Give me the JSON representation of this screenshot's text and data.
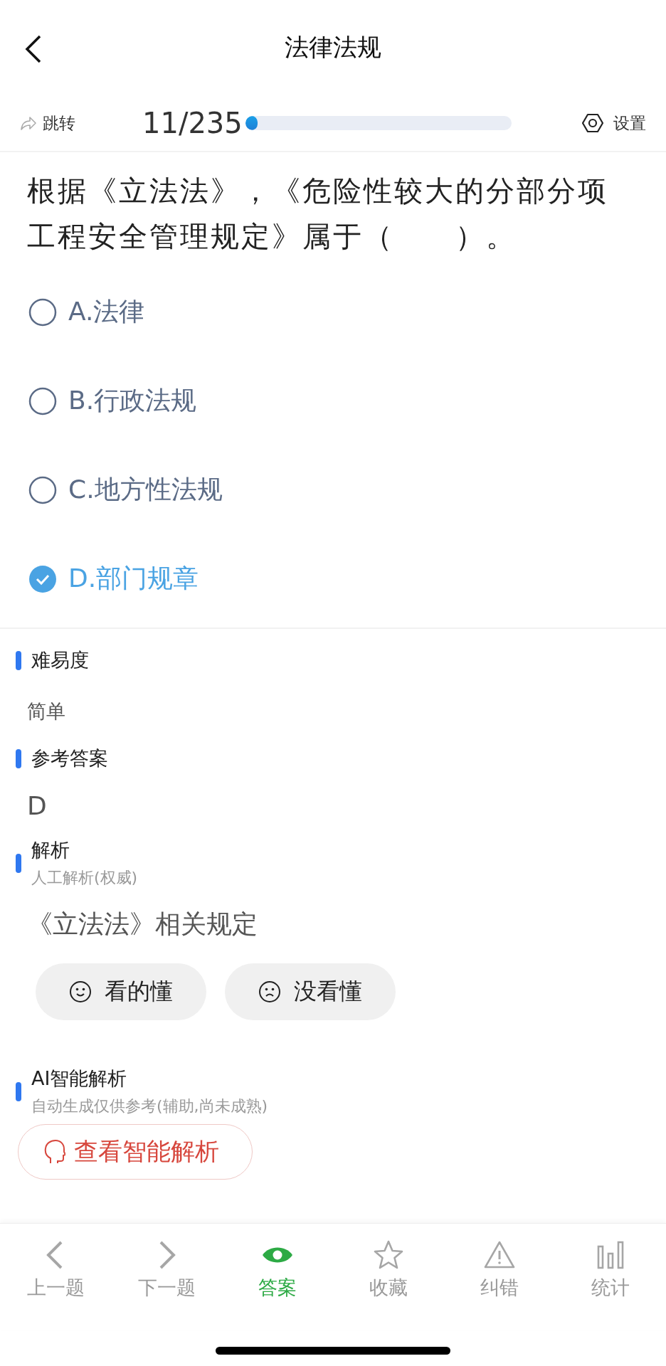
{
  "nav": {
    "title": "法律法规"
  },
  "toolbar": {
    "jump": "跳转",
    "counter": "11/235",
    "progress": {
      "level": 0.047
    },
    "settings": "设置"
  },
  "question": "根据《立法法》，《危险性较大的分部分项工程安全管理规定》属于（　　）。",
  "options": [
    {
      "label": "A.法律",
      "selected": false
    },
    {
      "label": "B.行政法规",
      "selected": false
    },
    {
      "label": "C.地方性法规",
      "selected": false
    },
    {
      "label": "D.部门规章",
      "selected": true
    }
  ],
  "difficulty": {
    "heading": "难易度",
    "value": "简单"
  },
  "answer": {
    "heading": "参考答案",
    "value": "D"
  },
  "analysis": {
    "heading": "解析",
    "subtitle": "人工解析(权威)",
    "text": "《立法法》相关规定",
    "feedback": [
      {
        "kind": "smile",
        "label": "看的懂"
      },
      {
        "kind": "frown",
        "label": "没看懂"
      }
    ]
  },
  "ai": {
    "heading": "AI智能解析",
    "subtitle": "自动生成仅供参考(辅助,尚未成熟)",
    "button": "查看智能解析"
  },
  "tabs": [
    {
      "kind": "prev",
      "label": "上一题",
      "selected": false
    },
    {
      "kind": "next",
      "label": "下一题",
      "selected": false
    },
    {
      "kind": "eye",
      "label": "答案",
      "selected": true
    },
    {
      "kind": "star",
      "label": "收藏",
      "selected": false
    },
    {
      "kind": "warning",
      "label": "纠错",
      "selected": false
    },
    {
      "kind": "stats",
      "label": "统计",
      "selected": false
    }
  ]
}
